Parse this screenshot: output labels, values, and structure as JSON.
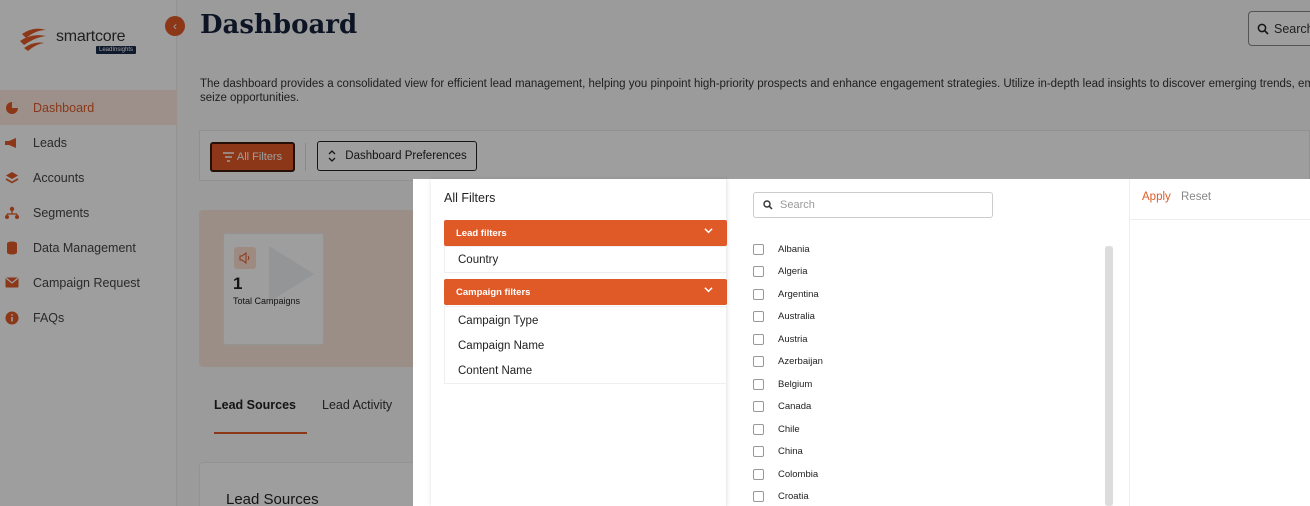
{
  "brand": {
    "name": "smartcore",
    "sub": "LeadInsights",
    "accent": "#e05a28"
  },
  "sidebar": {
    "items": [
      {
        "label": "Dashboard",
        "icon": "pie-chart-icon",
        "active": true
      },
      {
        "label": "Leads",
        "icon": "megaphone-icon"
      },
      {
        "label": "Accounts",
        "icon": "layers-icon"
      },
      {
        "label": "Segments",
        "icon": "segments-icon"
      },
      {
        "label": "Data Management",
        "icon": "database-icon"
      },
      {
        "label": "Campaign Request",
        "icon": "mail-icon"
      },
      {
        "label": "FAQs",
        "icon": "info-icon"
      }
    ]
  },
  "header": {
    "title": "Dashboard",
    "search_label": "Search",
    "description_1": "The dashboard provides a consolidated view for efficient lead management, helping you pinpoint high-priority prospects and enhance engagement strategies. Utilize in-depth lead insights to discover emerging trends, em",
    "description_2": "seize opportunities."
  },
  "toolbar": {
    "all_filters": "All Filters",
    "preferences": "Dashboard Preferences"
  },
  "stats": {
    "total_campaigns_value": "1",
    "total_campaigns_label": "Total Campaigns"
  },
  "tabs": [
    "Lead Sources",
    "Lead Activity"
  ],
  "section": {
    "title": "Lead Sources"
  },
  "filters_modal": {
    "title": "All Filters",
    "groups": [
      {
        "label": "Lead filters",
        "items": [
          "Country"
        ]
      },
      {
        "label": "Campaign filters",
        "items": [
          "Campaign Type",
          "Campaign Name",
          "Content Name"
        ]
      }
    ],
    "search_placeholder": "Search",
    "countries": [
      "Albania",
      "Algeria",
      "Argentina",
      "Australia",
      "Austria",
      "Azerbaijan",
      "Belgium",
      "Canada",
      "Chile",
      "China",
      "Colombia",
      "Croatia"
    ],
    "apply_label": "Apply",
    "reset_label": "Reset"
  }
}
